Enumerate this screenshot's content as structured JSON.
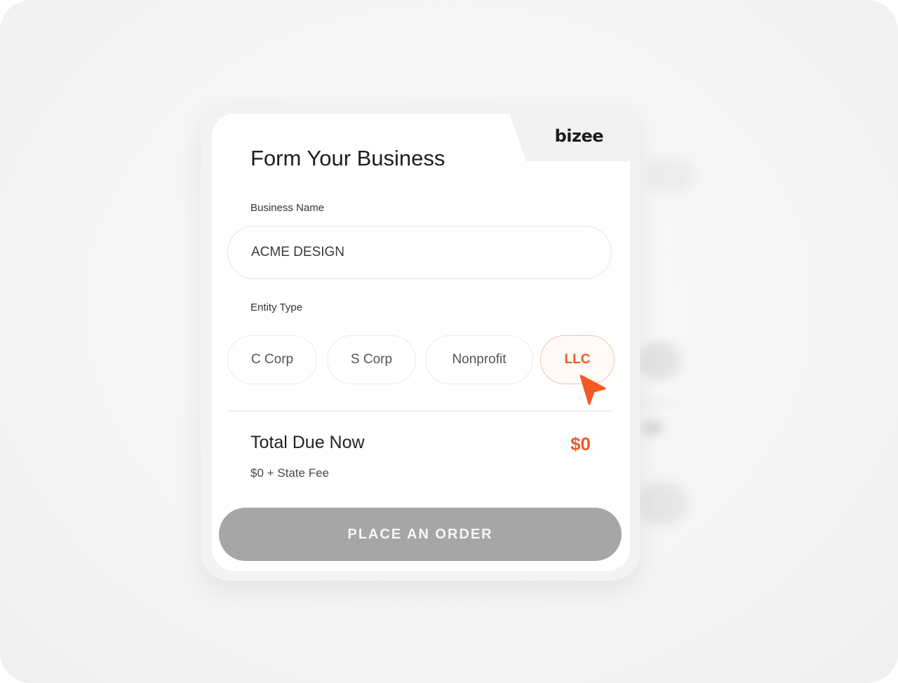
{
  "brand": {
    "logo_text": "bizee"
  },
  "form": {
    "title": "Form Your Business",
    "business_name": {
      "label": "Business Name",
      "value": "ACME DESIGN"
    },
    "entity_type": {
      "label": "Entity Type",
      "options": [
        "C Corp",
        "S Corp",
        "Nonprofit",
        "LLC"
      ],
      "selected": "LLC"
    }
  },
  "summary": {
    "total_label": "Total Due Now",
    "total_value": "$0",
    "fee_note": "$0 + State Fee"
  },
  "actions": {
    "order_label": "PLACE AN ORDER"
  },
  "colors": {
    "accent": "#f15a22",
    "button_bg": "#a6a6a6",
    "card_bg": "#ffffff",
    "page_bg": "#f5f5f5"
  },
  "icons": {
    "cursor": "cursor-arrow-icon"
  }
}
